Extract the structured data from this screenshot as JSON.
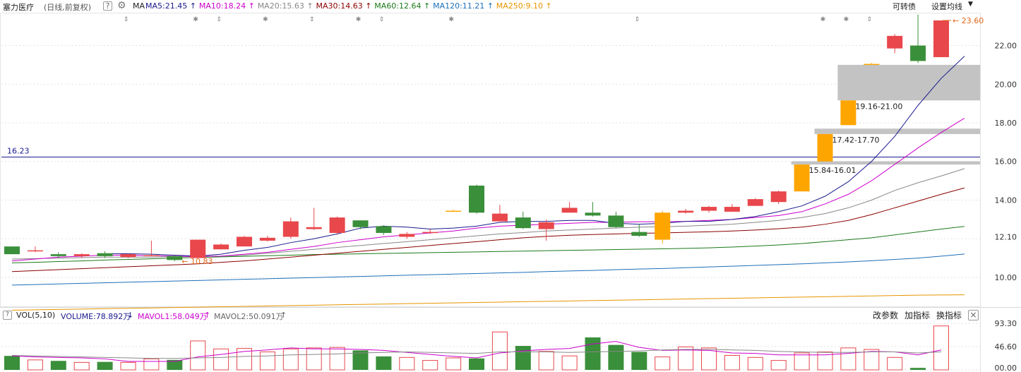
{
  "header": {
    "stock_name": "塞力医疗",
    "period": "(日线,前复权)",
    "help_icon": "?",
    "settings_icon": "gear-icon",
    "ma_label": "MA",
    "ma_items": [
      {
        "label": "MA5:21.45",
        "color": "#1a1a8c",
        "arrow": "↑"
      },
      {
        "label": "MA10:18.24",
        "color": "#cc00cc",
        "arrow": "↑"
      },
      {
        "label": "MA20:15.63",
        "color": "#888888",
        "arrow": "↑"
      },
      {
        "label": "MA30:14.63",
        "color": "#8b0000",
        "arrow": "↑"
      },
      {
        "label": "MA60:12.64",
        "color": "#1a7a1a",
        "arrow": "↑"
      },
      {
        "label": "MA120:11.21",
        "color": "#1e6fb8",
        "arrow": "↑"
      },
      {
        "label": "MA250:9.10",
        "color": "#e69500",
        "arrow": "↑"
      }
    ],
    "btn_convertible": "可转债",
    "btn_set_ma": "设置均线"
  },
  "vol_header": {
    "help_icon": "?",
    "label": "VOL(5,10)",
    "volume": "VOLUME:78.892万",
    "volume_arrow": "↓",
    "mavol1": "MAVOL1:58.049万",
    "mavol1_arrow": "↑",
    "mavol2": "MAVOL2:50.091万",
    "mavol2_arrow": "↑",
    "btn_params": "改参数",
    "btn_add": "加指标",
    "btn_switch": "换指标",
    "close_icon": "×"
  },
  "chart_data": {
    "type": "candlestick",
    "price_axis": {
      "ticks": [
        "22.00",
        "20.00",
        "18.00",
        "16.00",
        "14.00",
        "12.10",
        "10.00"
      ],
      "ylim": [
        8.5,
        23.7
      ]
    },
    "volume_axis": {
      "ticks": [
        "93.30",
        "46.60",
        "00.00"
      ],
      "ylim": [
        0,
        93.3
      ],
      "unit": "万"
    },
    "colors": {
      "up": "#e8474b",
      "down": "#3a8f3a",
      "limit_up": "#ffa500",
      "hline": "#1a1a8c",
      "zone": "#c0c0c0"
    },
    "candles": [
      {
        "o": 11.6,
        "h": 11.6,
        "l": 11.2,
        "c": 11.2
      },
      {
        "o": 11.4,
        "h": 11.6,
        "l": 11.3,
        "c": 11.4
      },
      {
        "o": 11.2,
        "h": 11.3,
        "l": 11.0,
        "c": 11.1
      },
      {
        "o": 11.1,
        "h": 11.25,
        "l": 11.0,
        "c": 11.2
      },
      {
        "o": 11.25,
        "h": 11.35,
        "l": 11.0,
        "c": 11.1
      },
      {
        "o": 11.05,
        "h": 11.25,
        "l": 11.0,
        "c": 11.2
      },
      {
        "o": 11.15,
        "h": 11.9,
        "l": 11.1,
        "c": 11.15
      },
      {
        "o": 11.1,
        "h": 11.15,
        "l": 10.83,
        "c": 10.9
      },
      {
        "o": 11.0,
        "h": 11.95,
        "l": 11.0,
        "c": 11.95
      },
      {
        "o": 11.45,
        "h": 11.75,
        "l": 11.45,
        "c": 11.7
      },
      {
        "o": 11.6,
        "h": 12.15,
        "l": 11.6,
        "c": 12.1
      },
      {
        "o": 11.9,
        "h": 12.15,
        "l": 11.85,
        "c": 12.05
      },
      {
        "o": 12.1,
        "h": 13.1,
        "l": 12.0,
        "c": 12.9
      },
      {
        "o": 12.5,
        "h": 13.6,
        "l": 12.45,
        "c": 12.6
      },
      {
        "o": 12.3,
        "h": 13.15,
        "l": 12.2,
        "c": 13.1
      },
      {
        "o": 12.95,
        "h": 12.95,
        "l": 12.5,
        "c": 12.6
      },
      {
        "o": 12.65,
        "h": 12.7,
        "l": 12.2,
        "c": 12.3
      },
      {
        "o": 12.1,
        "h": 12.35,
        "l": 12.0,
        "c": 12.25
      },
      {
        "o": 12.3,
        "h": 12.5,
        "l": 12.25,
        "c": 12.35
      },
      {
        "o": 13.45,
        "h": 13.5,
        "l": 13.4,
        "c": 13.45
      },
      {
        "o": 14.75,
        "h": 14.8,
        "l": 13.3,
        "c": 13.35
      },
      {
        "o": 12.9,
        "h": 13.75,
        "l": 12.9,
        "c": 13.3
      },
      {
        "o": 13.1,
        "h": 13.4,
        "l": 12.5,
        "c": 12.55
      },
      {
        "o": 12.5,
        "h": 13.0,
        "l": 11.9,
        "c": 12.85
      },
      {
        "o": 13.35,
        "h": 13.9,
        "l": 13.35,
        "c": 13.6
      },
      {
        "o": 13.35,
        "h": 13.9,
        "l": 13.15,
        "c": 13.2
      },
      {
        "o": 13.2,
        "h": 13.4,
        "l": 12.55,
        "c": 12.6
      },
      {
        "o": 12.35,
        "h": 12.75,
        "l": 12.1,
        "c": 12.15
      },
      {
        "o": 11.95,
        "h": 13.45,
        "l": 11.75,
        "c": 13.35
      },
      {
        "o": 13.35,
        "h": 13.55,
        "l": 13.3,
        "c": 13.45
      },
      {
        "o": 13.45,
        "h": 13.7,
        "l": 13.35,
        "c": 13.65
      },
      {
        "o": 13.4,
        "h": 13.8,
        "l": 13.4,
        "c": 13.65
      },
      {
        "o": 13.7,
        "h": 14.1,
        "l": 13.7,
        "c": 14.05
      },
      {
        "o": 13.9,
        "h": 14.5,
        "l": 13.8,
        "c": 14.45
      },
      {
        "o": 14.45,
        "h": 15.84,
        "l": 14.45,
        "c": 15.84
      },
      {
        "o": 16.0,
        "h": 17.42,
        "l": 16.0,
        "c": 17.42
      },
      {
        "o": 17.88,
        "h": 19.16,
        "l": 17.88,
        "c": 19.16
      },
      {
        "o": 21.05,
        "h": 21.1,
        "l": 21.0,
        "c": 21.05
      },
      {
        "o": 21.85,
        "h": 22.6,
        "l": 21.6,
        "c": 22.5
      },
      {
        "o": 22.0,
        "h": 23.6,
        "l": 21.1,
        "c": 21.2
      },
      {
        "o": 21.4,
        "h": 23.3,
        "l": 21.4,
        "c": 23.3
      }
    ],
    "limit_up_indices": [
      19,
      28,
      34,
      35,
      36,
      37
    ],
    "volumes": [
      28,
      20,
      18,
      15,
      16,
      15,
      22,
      20,
      58,
      42,
      43,
      36,
      42,
      44,
      45,
      39,
      27,
      25,
      19,
      24,
      23,
      76,
      48,
      37,
      28,
      65,
      50,
      36,
      26,
      46,
      44,
      29,
      25,
      19,
      34,
      36,
      44,
      41,
      25,
      4,
      88,
      93,
      79
    ],
    "ma5": [
      null,
      null,
      null,
      null,
      11.22,
      11.22,
      11.2,
      11.15,
      11.1,
      11.2,
      11.4,
      11.55,
      11.8,
      12.0,
      12.25,
      12.55,
      12.65,
      12.6,
      12.5,
      12.55,
      12.65,
      12.85,
      12.9,
      12.9,
      12.95,
      12.95,
      12.8,
      12.75,
      12.8,
      12.9,
      12.9,
      13.0,
      13.15,
      13.4,
      13.7,
      14.2,
      14.95,
      16.0,
      17.3,
      18.9,
      20.3,
      21.45
    ],
    "ma10": [
      10.85,
      10.95,
      11.05,
      11.1,
      11.15,
      11.15,
      11.12,
      11.1,
      11.08,
      11.1,
      11.2,
      11.3,
      11.45,
      11.6,
      11.8,
      11.95,
      12.1,
      12.2,
      12.3,
      12.4,
      12.55,
      12.65,
      12.7,
      12.75,
      12.8,
      12.85,
      12.85,
      12.88,
      12.88,
      12.9,
      12.95,
      13.0,
      13.1,
      13.2,
      13.4,
      13.8,
      14.3,
      15.0,
      15.85,
      16.7,
      17.5,
      18.24
    ],
    "ma20": [
      10.95,
      10.97,
      11.0,
      11.02,
      11.05,
      11.05,
      11.05,
      11.07,
      11.08,
      11.1,
      11.15,
      11.25,
      11.35,
      11.45,
      11.55,
      11.65,
      11.75,
      11.85,
      11.95,
      12.05,
      12.15,
      12.25,
      12.32,
      12.4,
      12.45,
      12.5,
      12.55,
      12.6,
      12.62,
      12.65,
      12.7,
      12.75,
      12.85,
      12.95,
      13.1,
      13.3,
      13.6,
      14.0,
      14.5,
      14.9,
      15.25,
      15.63
    ],
    "ma30": [
      10.3,
      10.35,
      10.4,
      10.45,
      10.5,
      10.55,
      10.6,
      10.65,
      10.7,
      10.78,
      10.85,
      10.95,
      11.05,
      11.15,
      11.25,
      11.35,
      11.45,
      11.55,
      11.65,
      11.75,
      11.85,
      11.95,
      12.05,
      12.12,
      12.18,
      12.22,
      12.25,
      12.28,
      12.3,
      12.33,
      12.36,
      12.4,
      12.45,
      12.52,
      12.6,
      12.75,
      12.95,
      13.25,
      13.6,
      13.95,
      14.3,
      14.63
    ],
    "ma60": [
      10.75,
      10.78,
      10.82,
      10.85,
      10.9,
      10.93,
      10.96,
      11.0,
      11.03,
      11.06,
      11.09,
      11.12,
      11.15,
      11.18,
      11.2,
      11.22,
      11.24,
      11.26,
      11.28,
      11.3,
      11.32,
      11.34,
      11.36,
      11.38,
      11.4,
      11.42,
      11.44,
      11.46,
      11.48,
      11.5,
      11.53,
      11.57,
      11.62,
      11.68,
      11.75,
      11.85,
      11.95,
      12.05,
      12.2,
      12.35,
      12.5,
      12.64
    ],
    "ma120": [
      9.6,
      9.63,
      9.66,
      9.69,
      9.72,
      9.75,
      9.78,
      9.81,
      9.84,
      9.87,
      9.9,
      9.93,
      9.96,
      9.99,
      10.02,
      10.05,
      10.08,
      10.11,
      10.14,
      10.17,
      10.2,
      10.23,
      10.26,
      10.3,
      10.33,
      10.36,
      10.4,
      10.43,
      10.46,
      10.5,
      10.54,
      10.58,
      10.62,
      10.66,
      10.7,
      10.75,
      10.8,
      10.86,
      10.93,
      11.0,
      11.1,
      11.21
    ],
    "ma250": [
      8.3,
      8.32,
      8.34,
      8.36,
      8.38,
      8.4,
      8.42,
      8.44,
      8.46,
      8.48,
      8.5,
      8.52,
      8.54,
      8.56,
      8.58,
      8.6,
      8.62,
      8.64,
      8.66,
      8.68,
      8.7,
      8.72,
      8.74,
      8.76,
      8.78,
      8.8,
      8.82,
      8.84,
      8.86,
      8.88,
      8.9,
      8.92,
      8.94,
      8.96,
      8.98,
      9.0,
      9.02,
      9.04,
      9.06,
      9.08,
      9.09,
      9.1
    ],
    "mavol1": [
      28,
      26,
      25,
      24,
      22,
      17,
      17,
      17,
      26,
      31,
      37,
      40,
      44,
      42,
      42,
      41,
      39,
      35,
      31,
      27,
      24,
      34,
      38,
      41,
      43,
      52,
      57,
      45,
      39,
      40,
      39,
      34,
      33,
      30,
      30,
      30,
      33,
      37,
      36,
      30,
      40,
      50,
      58
    ],
    "mavol2": [
      29,
      28,
      27,
      26,
      25,
      24,
      23,
      23,
      24,
      25,
      27,
      28,
      30,
      31,
      32,
      34,
      35,
      36,
      35,
      34,
      33,
      36,
      36,
      36,
      35,
      36,
      37,
      38,
      40,
      41,
      41,
      40,
      39,
      37,
      36,
      35,
      35,
      36,
      36,
      34,
      36,
      43,
      50
    ],
    "hline": {
      "value": 16.23,
      "label": "16.23"
    },
    "zones": [
      {
        "label": "19.16-21.00",
        "low": 19.16,
        "high": 21.0
      },
      {
        "label": "17.42-17.70",
        "low": 17.42,
        "high": 17.7
      },
      {
        "label": "15.84-16.01",
        "low": 15.84,
        "high": 16.01
      }
    ],
    "annotations": {
      "high": "23.60",
      "low": "10.83"
    },
    "marker_symbols": [
      "⇕",
      "✱",
      "⇕",
      "✱",
      "⇕",
      "✱",
      "⇕",
      "✱",
      "⇕",
      "✱",
      "✱",
      "⇕"
    ]
  }
}
